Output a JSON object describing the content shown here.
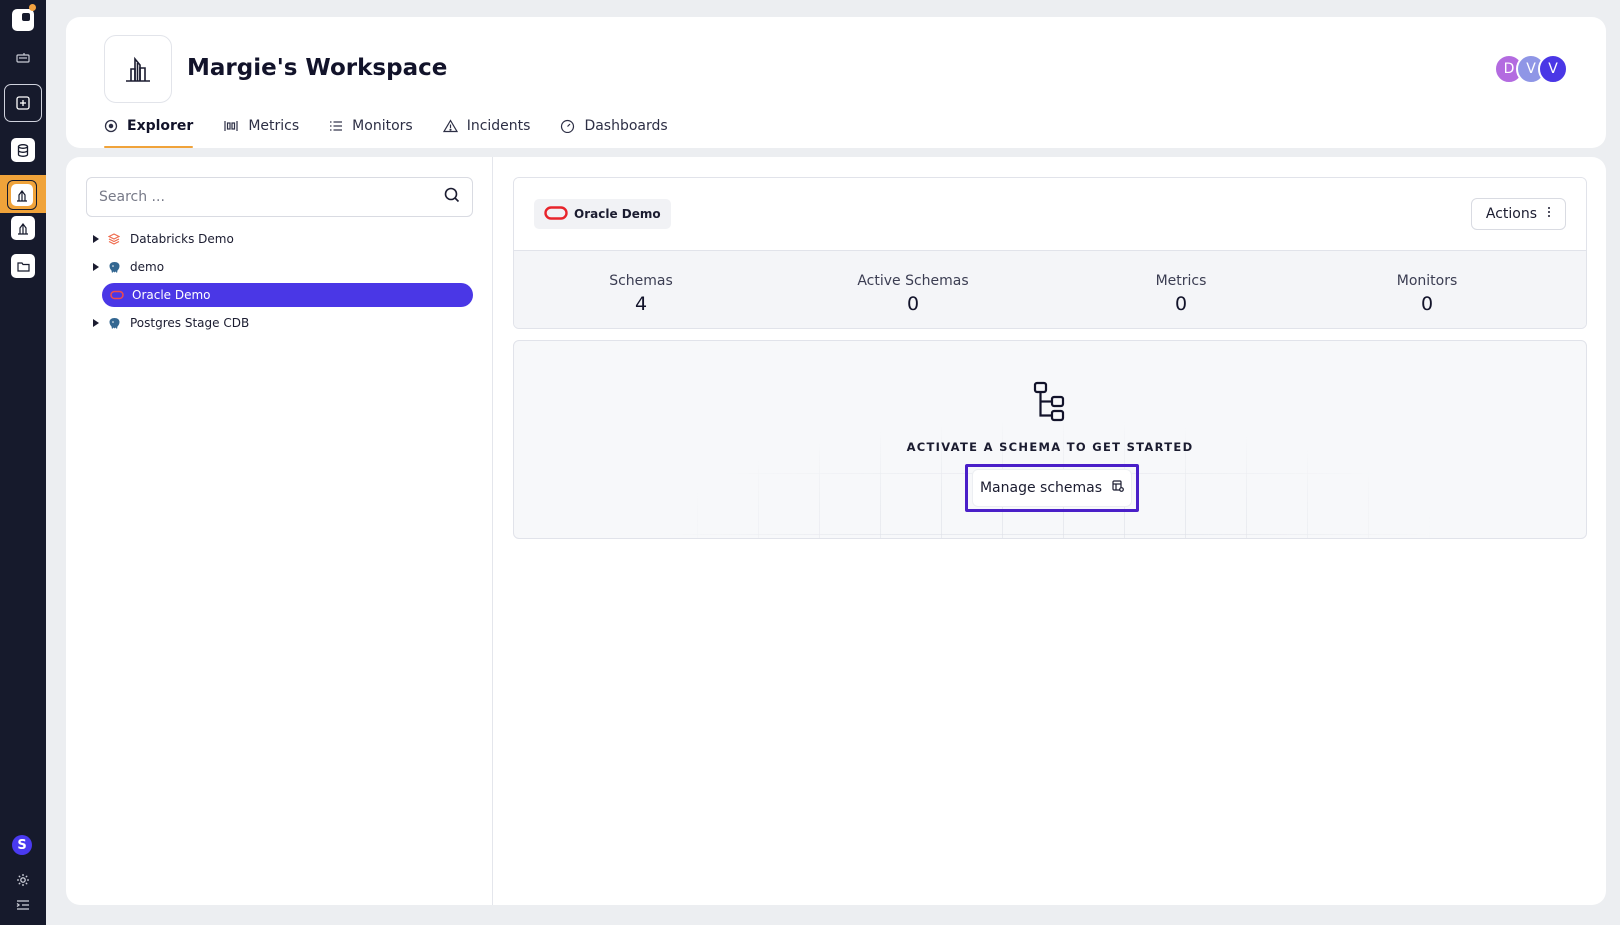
{
  "workspace": {
    "title": "Margie's Workspace"
  },
  "avatars": [
    {
      "initial": "D",
      "color": "#b36be0"
    },
    {
      "initial": "V",
      "color": "#8f96e6"
    },
    {
      "initial": "V",
      "color": "#4a37e6"
    }
  ],
  "tabs": [
    {
      "label": "Explorer",
      "icon": "explorer-icon",
      "active": true
    },
    {
      "label": "Metrics",
      "icon": "metrics-icon"
    },
    {
      "label": "Monitors",
      "icon": "list-icon"
    },
    {
      "label": "Incidents",
      "icon": "warning-icon"
    },
    {
      "label": "Dashboards",
      "icon": "gauge-icon"
    }
  ],
  "search": {
    "placeholder": "Search ..."
  },
  "tree": [
    {
      "label": "Databricks Demo",
      "icon": "databricks-icon",
      "expandable": true
    },
    {
      "label": "demo",
      "icon": "postgres-icon",
      "expandable": true
    },
    {
      "label": "Oracle Demo",
      "icon": "oracle-icon",
      "selected": true
    },
    {
      "label": "Postgres Stage CDB",
      "icon": "postgres-icon",
      "expandable": true
    }
  ],
  "source": {
    "name": "Oracle Demo",
    "actions_label": "Actions"
  },
  "stats": [
    {
      "label": "Schemas",
      "value": "4"
    },
    {
      "label": "Active Schemas",
      "value": "0"
    },
    {
      "label": "Metrics",
      "value": "0"
    },
    {
      "label": "Monitors",
      "value": "0"
    }
  ],
  "empty_state": {
    "message": "ACTIVATE A SCHEMA TO GET STARTED",
    "button_label": "Manage schemas"
  },
  "colors": {
    "accent": "#4a37e6",
    "highlight": "#f0a33a",
    "rail": "#161a2c"
  }
}
